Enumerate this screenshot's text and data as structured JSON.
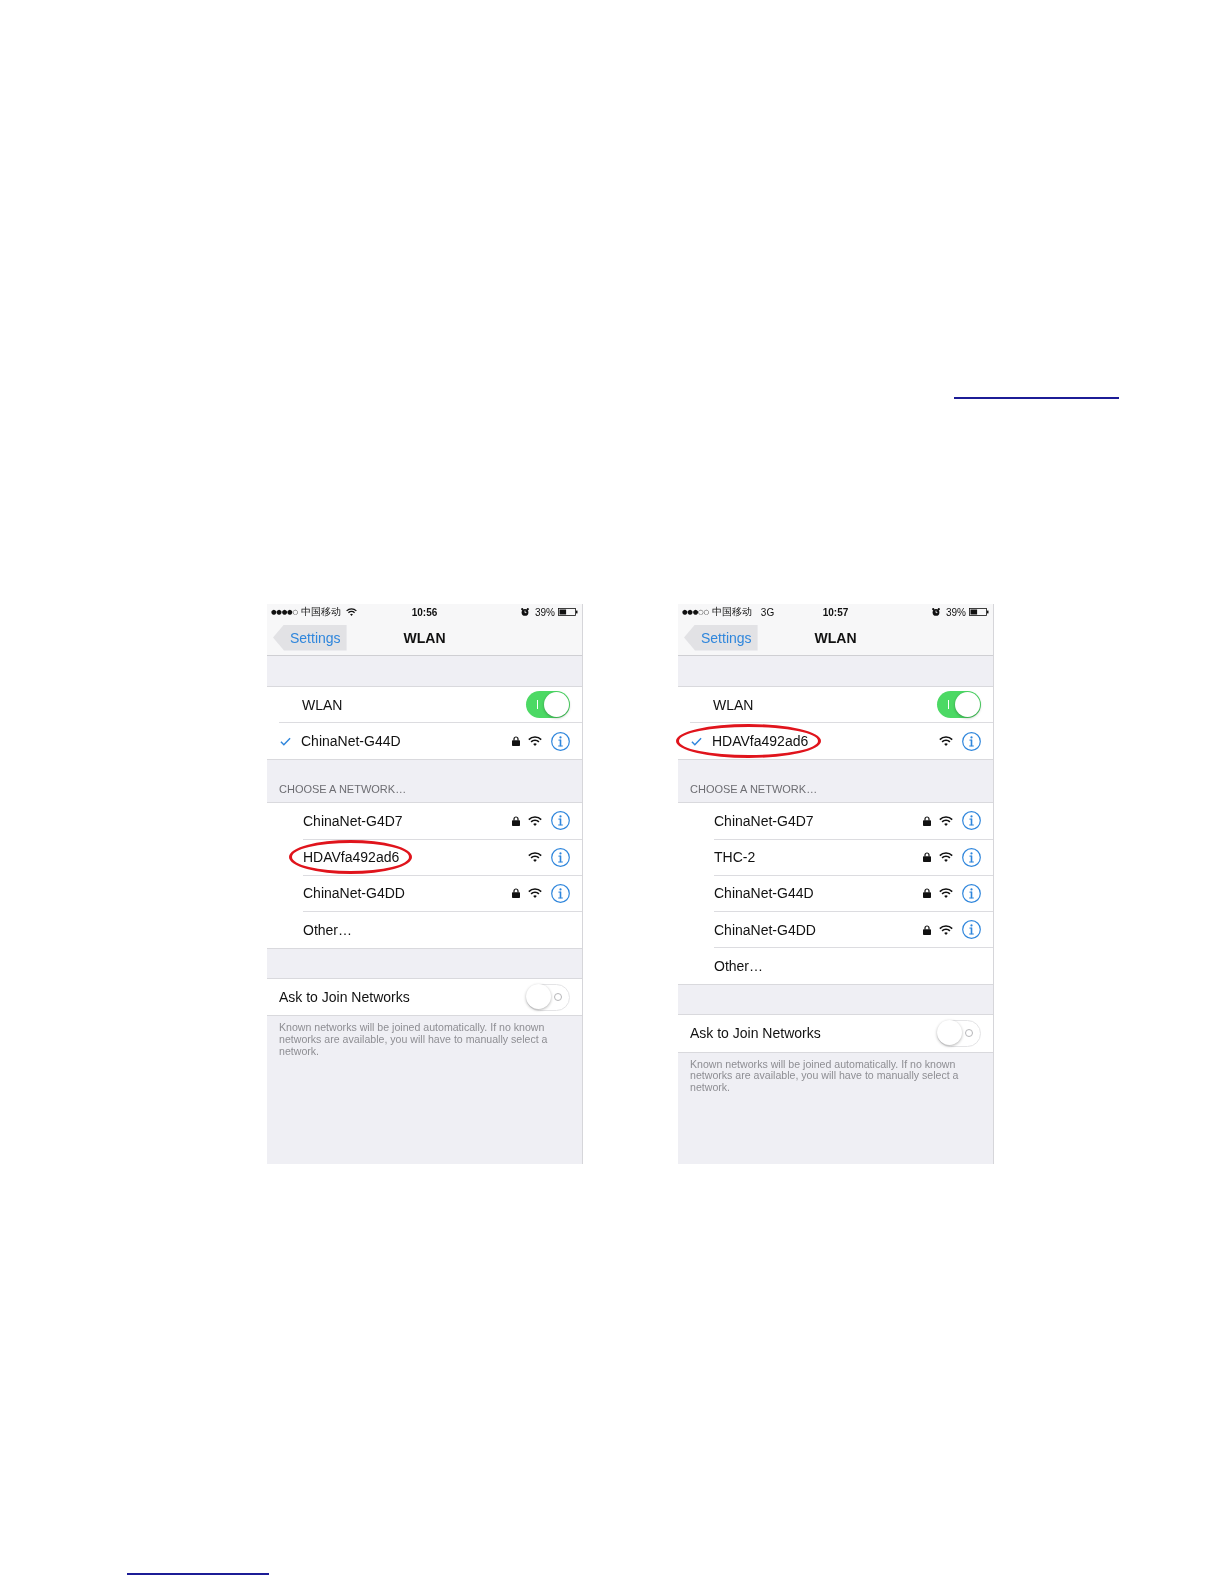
{
  "phones": [
    {
      "status_bar": {
        "signal": "●●●●○",
        "carrier": "中国移动",
        "wifi": true,
        "time": "10:56",
        "battery": "39%"
      },
      "nav": {
        "back": "Settings",
        "title": "WLAN"
      },
      "wlan": {
        "label": "WLAN",
        "on": true
      },
      "current_network": {
        "name": "ChinaNet-G44D",
        "checked": true,
        "locked": true,
        "circled": false
      },
      "section_header": "CHOOSE A NETWORK…",
      "networks": [
        {
          "kind": "network",
          "name": "ChinaNet-G4D7",
          "locked": true,
          "circled": false
        },
        {
          "kind": "network",
          "name": "HDAVfa492ad6",
          "locked": false,
          "circled": true
        },
        {
          "kind": "network",
          "name": "ChinaNet-G4DD",
          "locked": true,
          "circled": false
        },
        {
          "kind": "other",
          "name": "Other…"
        }
      ],
      "ask_to_join": {
        "label": "Ask to Join Networks",
        "on": false
      },
      "footer": "Known networks will be joined automatically. If no known networks are available, you will have to manually select a network."
    },
    {
      "status_bar": {
        "signal": "●●●○○",
        "carrier": "中国移动",
        "wifi": false,
        "network_type": "3G",
        "time": "10:57",
        "battery": "39%"
      },
      "nav": {
        "back": "Settings",
        "title": "WLAN"
      },
      "wlan": {
        "label": "WLAN",
        "on": true
      },
      "current_network": {
        "name": "HDAVfa492ad6",
        "checked": true,
        "locked": false,
        "circled": true
      },
      "section_header": "CHOOSE A NETWORK…",
      "networks": [
        {
          "kind": "network",
          "name": "ChinaNet-G4D7",
          "locked": true,
          "circled": false
        },
        {
          "kind": "network",
          "name": "THC-2",
          "locked": true,
          "circled": false
        },
        {
          "kind": "network",
          "name": "ChinaNet-G44D",
          "locked": true,
          "circled": false
        },
        {
          "kind": "network",
          "name": "ChinaNet-G4DD",
          "locked": true,
          "circled": false
        },
        {
          "kind": "other",
          "name": "Other…"
        }
      ],
      "ask_to_join": {
        "label": "Ask to Join Networks",
        "on": false
      },
      "footer": "Known networks will be joined automatically. If no known networks are available, you will have to manually select a network."
    }
  ]
}
